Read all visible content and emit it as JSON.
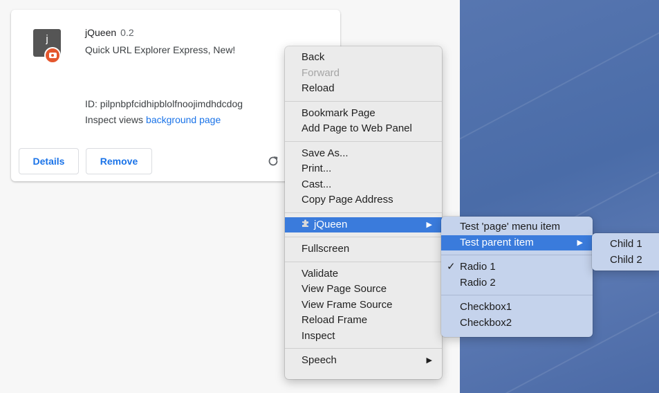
{
  "extension": {
    "icon_letter": "j",
    "name": "jQueen",
    "version": "0.2",
    "description": "Quick URL Explorer Express, New!",
    "id_text": "ID: pilpnbpfcidhipblolfnoojimdhdcdog",
    "inspect_label": "Inspect views",
    "inspect_link": "background page",
    "details_label": "Details",
    "remove_label": "Remove",
    "reload_icon": "reload-icon"
  },
  "context_menu": {
    "back": "Back",
    "forward": "Forward",
    "reload": "Reload",
    "bookmark": "Bookmark Page",
    "add_web_panel": "Add Page to Web Panel",
    "save_as": "Save As...",
    "print": "Print...",
    "cast": "Cast...",
    "copy_address": "Copy Page Address",
    "extension_item": "jQueen",
    "fullscreen": "Fullscreen",
    "validate": "Validate",
    "view_page_source": "View Page Source",
    "view_frame_source": "View Frame Source",
    "reload_frame": "Reload Frame",
    "inspect": "Inspect",
    "speech": "Speech"
  },
  "submenu": {
    "test_page": "Test 'page' menu item",
    "test_parent": "Test parent item",
    "radio1": "Radio 1",
    "radio2": "Radio 2",
    "checkbox1": "Checkbox1",
    "checkbox2": "Checkbox2",
    "checkmark": "✓"
  },
  "child_menu": {
    "child1": "Child 1",
    "child2": "Child 2"
  },
  "colors": {
    "highlight": "#3a7bdc",
    "link": "#1a73e8",
    "badge": "#e4572e",
    "desktop": "#4a6ca8"
  }
}
